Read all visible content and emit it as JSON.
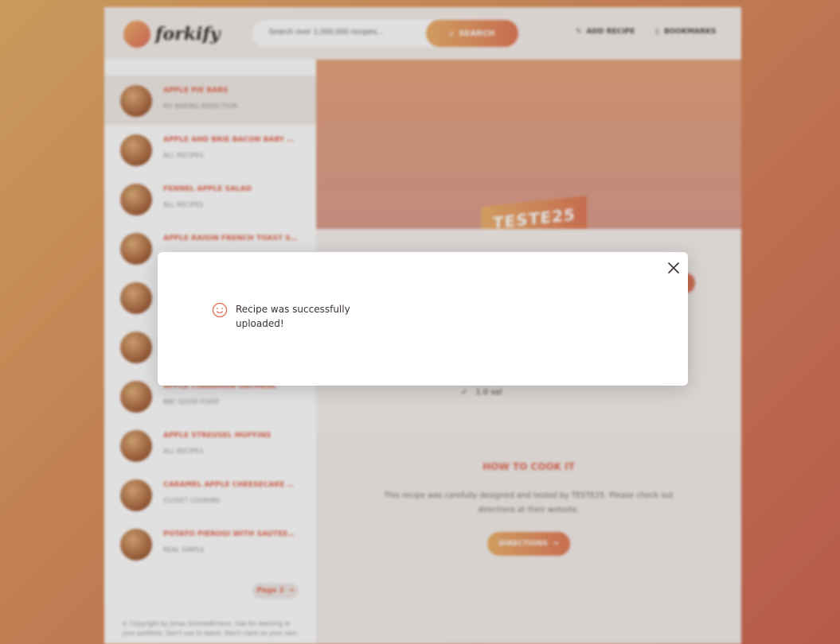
{
  "header": {
    "logo_text": "forkify",
    "search_placeholder": "Search over 1,000,000 recipes...",
    "search_button": "SEARCH",
    "nav_add_recipe": "ADD RECIPE",
    "nav_bookmarks": "BOOKMARKS"
  },
  "sidebar": {
    "items": [
      {
        "title": "Apple Pie Bars",
        "publisher": "My Baking Addiction"
      },
      {
        "title": "Apple and Brie Bacon Baby Bagels",
        "publisher": "All Recipes"
      },
      {
        "title": "Fennel Apple Salad",
        "publisher": "All Recipes"
      },
      {
        "title": "Apple Raisin French Toast Strata",
        "publisher": ""
      },
      {
        "title": "",
        "publisher": ""
      },
      {
        "title": "",
        "publisher": ""
      },
      {
        "title": "Apple Cinnamon Oatmeal",
        "publisher": "BBC Good Food"
      },
      {
        "title": "Apple Streusel Muffins",
        "publisher": "All Recipes"
      },
      {
        "title": "Caramel Apple Cheesecake Bars",
        "publisher": "Closet Cooking"
      },
      {
        "title": "Potato Pierogi with Sautéed Apples",
        "publisher": "Real Simple"
      }
    ],
    "page_button": "Page 2",
    "copyright": "© Copyright by Jonas Schmedtmann. Use for learning or your portfolio. Don't use to teach. Don't claim as your own."
  },
  "recipe": {
    "title": "TESTE25",
    "ingredient": "1.0 sal",
    "cook_heading": "How to cook it",
    "cook_text": "This recipe was carefully designed and tested by TESTE25. Please check out directions at their website.",
    "directions_button": "DIRECTIONS"
  },
  "modal": {
    "message": "Recipe was successfully uploaded!"
  },
  "colors": {
    "accent": "#e46d55",
    "gradient_start": "#edb26e",
    "gradient_end": "#e27c5a"
  }
}
